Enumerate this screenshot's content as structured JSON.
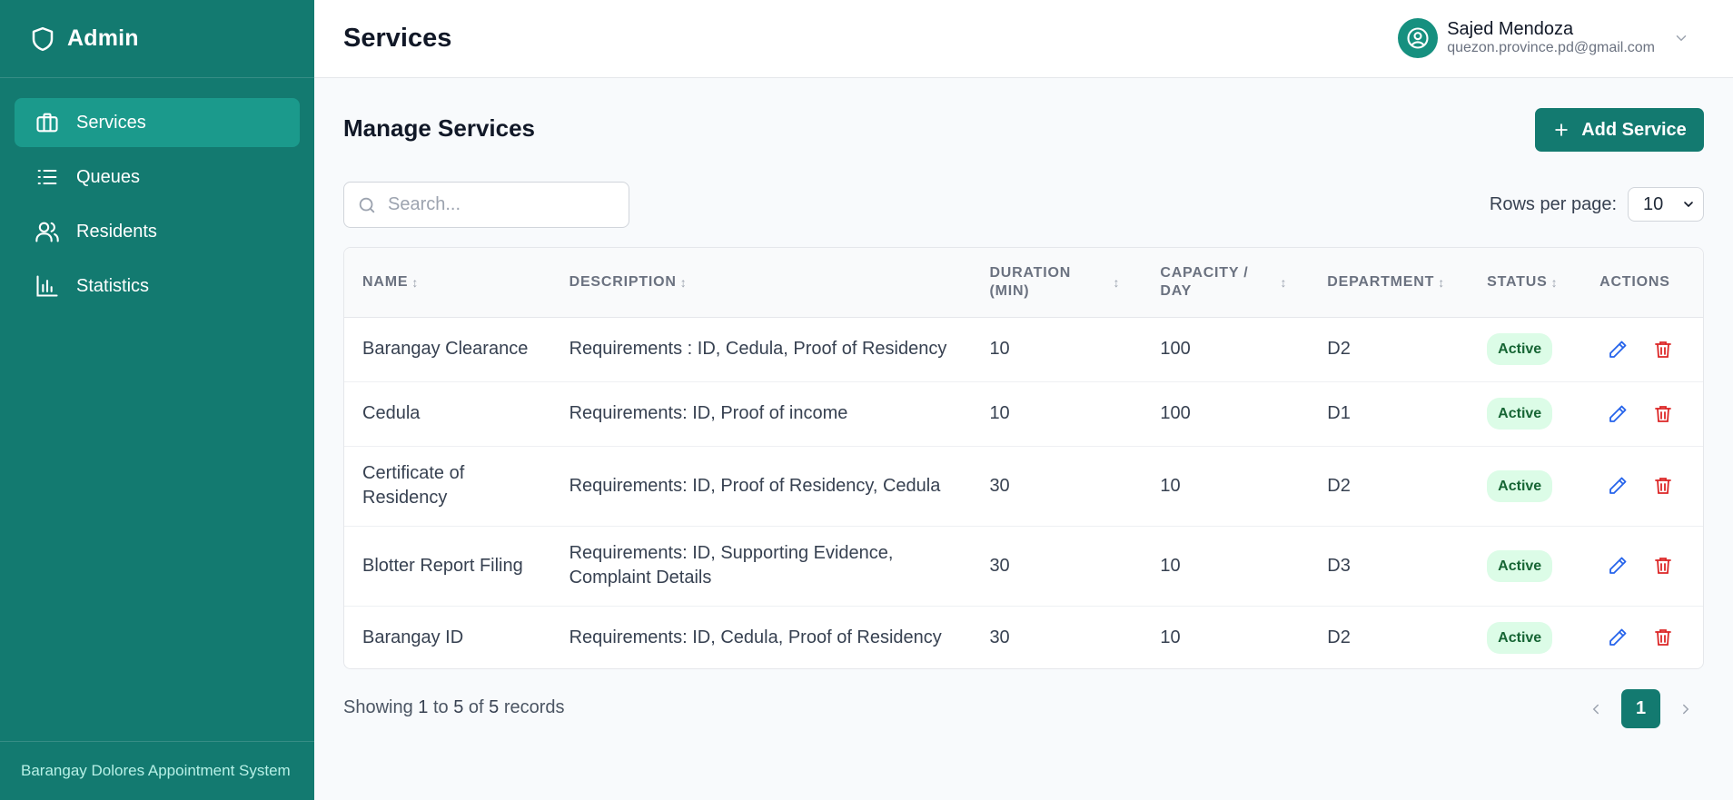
{
  "brand": {
    "title": "Admin"
  },
  "sidebar": {
    "items": [
      {
        "label": "Services",
        "icon": "briefcase-icon",
        "active": true
      },
      {
        "label": "Queues",
        "icon": "list-icon",
        "active": false
      },
      {
        "label": "Residents",
        "icon": "users-icon",
        "active": false
      },
      {
        "label": "Statistics",
        "icon": "bar-chart-icon",
        "active": false
      }
    ],
    "footer": "Barangay Dolores Appointment System"
  },
  "header": {
    "title": "Services",
    "user": {
      "name": "Sajed Mendoza",
      "email": "quezon.province.pd@gmail.com"
    }
  },
  "main": {
    "section_title": "Manage Services",
    "add_button": "Add Service",
    "search_placeholder": "Search...",
    "rows_per_page_label": "Rows per page:",
    "rows_per_page_value": "10"
  },
  "table": {
    "headers": {
      "name": "NAME",
      "description": "DESCRIPTION",
      "duration": "DURATION (MIN)",
      "capacity": "CAPACITY / DAY",
      "department": "DEPARTMENT",
      "status": "STATUS",
      "actions": "ACTIONS"
    },
    "rows": [
      {
        "name": "Barangay Clearance",
        "description": "Requirements : ID, Cedula, Proof of Residency",
        "duration": "10",
        "capacity": "100",
        "department": "D2",
        "status": "Active"
      },
      {
        "name": "Cedula",
        "description": "Requirements: ID, Proof of income",
        "duration": "10",
        "capacity": "100",
        "department": "D1",
        "status": "Active"
      },
      {
        "name": "Certificate of Residency",
        "description": "Requirements: ID, Proof of Residency, Cedula",
        "duration": "30",
        "capacity": "10",
        "department": "D2",
        "status": "Active"
      },
      {
        "name": "Blotter Report Filing",
        "description": "Requirements: ID, Supporting Evidence, Complaint Details",
        "duration": "30",
        "capacity": "10",
        "department": "D3",
        "status": "Active"
      },
      {
        "name": "Barangay ID",
        "description": "Requirements: ID, Cedula, Proof of Residency",
        "duration": "30",
        "capacity": "10",
        "department": "D2",
        "status": "Active"
      }
    ]
  },
  "footer": {
    "showing_prefix": "Showing",
    "from": "1",
    "to_word": "to",
    "to": "5",
    "of_word": "of",
    "total": "5",
    "suffix": "records",
    "current_page": "1"
  },
  "colors": {
    "primary": "#137a70",
    "active_nav": "#1b9a8c",
    "edit": "#2563eb",
    "delete": "#dc2626",
    "badge_bg": "#dcfce7",
    "badge_text": "#166534"
  }
}
